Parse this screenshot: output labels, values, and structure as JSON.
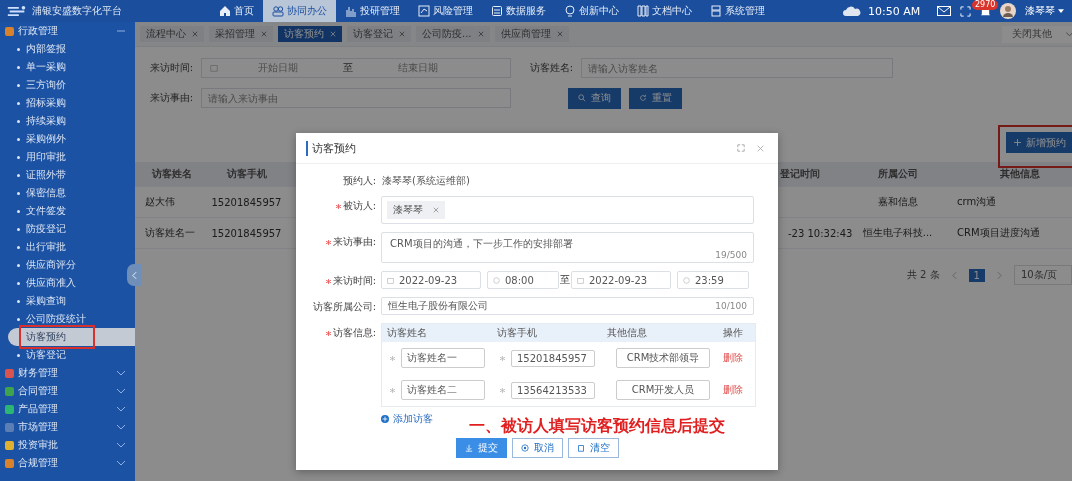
{
  "header": {
    "logo": "浦银安盛数字化平台",
    "nav": [
      {
        "label": "首页",
        "selected": false
      },
      {
        "label": "协同办公",
        "selected": true
      },
      {
        "label": "投研管理",
        "selected": false
      },
      {
        "label": "风险管理",
        "selected": false
      },
      {
        "label": "数据服务",
        "selected": false
      },
      {
        "label": "创新中心",
        "selected": false
      },
      {
        "label": "文档中心",
        "selected": false
      },
      {
        "label": "系统管理",
        "selected": false
      }
    ],
    "time": "10:50 AM",
    "badge": "2970",
    "user": "漆琴琴"
  },
  "sidebar": {
    "groups": [
      {
        "label": "行政管理",
        "color": "#d9822b",
        "expanded": true,
        "children": [
          {
            "label": "内部签报",
            "selected": false,
            "highlighted": false
          },
          {
            "label": "单一采购",
            "selected": false,
            "highlighted": false
          },
          {
            "label": "三方询价",
            "selected": false,
            "highlighted": false
          },
          {
            "label": "招标采购",
            "selected": false,
            "highlighted": false
          },
          {
            "label": "持续采购",
            "selected": false,
            "highlighted": false
          },
          {
            "label": "采购例外",
            "selected": false,
            "highlighted": false
          },
          {
            "label": "用印审批",
            "selected": false,
            "highlighted": false
          },
          {
            "label": "证照外带",
            "selected": false,
            "highlighted": false
          },
          {
            "label": "保密信息",
            "selected": false,
            "highlighted": false
          },
          {
            "label": "文件签发",
            "selected": false,
            "highlighted": false
          },
          {
            "label": "防疫登记",
            "selected": false,
            "highlighted": false
          },
          {
            "label": "出行审批",
            "selected": false,
            "highlighted": false
          },
          {
            "label": "供应商评分",
            "selected": false,
            "highlighted": false
          },
          {
            "label": "供应商准入",
            "selected": false,
            "highlighted": false
          },
          {
            "label": "采购查询",
            "selected": false,
            "highlighted": false
          },
          {
            "label": "公司防疫统计",
            "selected": false,
            "highlighted": false
          },
          {
            "label": "访客预约",
            "selected": true,
            "highlighted": true
          },
          {
            "label": "访客登记",
            "selected": false,
            "highlighted": false
          }
        ]
      },
      {
        "label": "财务管理",
        "color": "#d9534f",
        "expanded": false
      },
      {
        "label": "合同管理",
        "color": "#3fa34d",
        "expanded": false
      },
      {
        "label": "产品管理",
        "color": "#2bb673",
        "expanded": false
      },
      {
        "label": "市场管理",
        "color": "#5b7fb5",
        "expanded": false
      },
      {
        "label": "投资审批",
        "color": "#e0b030",
        "expanded": false
      },
      {
        "label": "合规管理",
        "color": "#d9822b",
        "expanded": false
      }
    ]
  },
  "tabs": [
    {
      "label": "流程中心",
      "selected": false
    },
    {
      "label": "采招管理",
      "selected": false
    },
    {
      "label": "访客预约",
      "selected": true
    },
    {
      "label": "访客登记",
      "selected": false
    },
    {
      "label": "公司防疫...",
      "selected": false
    },
    {
      "label": "供应商管理",
      "selected": false
    }
  ],
  "tabs_menu": "关闭其他",
  "search": {
    "visit_time": {
      "label": "来访时间:",
      "start_placeholder": "开始日期",
      "separator": "至",
      "end_placeholder": "结束日期"
    },
    "visitor_name": {
      "label": "访客姓名:",
      "placeholder": "请输入访客姓名"
    },
    "reason": {
      "label": "来访事由:",
      "placeholder": "请输入来访事由"
    },
    "buttons": [
      "查询",
      "重置"
    ]
  },
  "add_button": {
    "label": "新增预约",
    "highlighted": true
  },
  "table": {
    "columns": [
      "访客姓名",
      "访客手机",
      "登记时间",
      "所属公司",
      "其他信息"
    ],
    "rows": [
      {
        "visitor_name": "赵大伟",
        "visitor_phone": "15201845957",
        "company": "嘉和信息",
        "other_info": "crm沟通"
      },
      {
        "visitor_name": "访客姓名一",
        "visitor_phone": "15201845957",
        "registered_time": "-23 10:32:43",
        "company": "恒生电子科技...",
        "other_info": "CRM项目进度沟通"
      }
    ]
  },
  "pagination": {
    "total": "共 2 条",
    "pages": [
      {
        "label": "1",
        "selected": true
      }
    ],
    "page_size": "10条/页"
  },
  "modal": {
    "title": "访客预约",
    "booker": {
      "label": "预约人:",
      "value": "漆琴琴(系统运维部)"
    },
    "host": {
      "label": "被访人:",
      "required": true,
      "tags": [
        "漆琴琴"
      ]
    },
    "reason": {
      "label": "来访事由:",
      "required": true,
      "value": "CRM项目的沟通，下一步工作的安排部署",
      "count": "19/500"
    },
    "time": {
      "label": "来访时间:",
      "required": true,
      "start_date": "2022-09-23",
      "start_time": "08:00",
      "separator": "至",
      "end_date": "2022-09-23",
      "end_time": "23:59"
    },
    "company": {
      "label": "访客所属公司:",
      "required": false,
      "value": "恒生电子股份有限公司",
      "count": "10/100"
    },
    "visitors": {
      "label": "访客信息:",
      "required": true,
      "columns": [
        "访客姓名",
        "访客手机",
        "其他信息",
        "操作"
      ],
      "rows": [
        {
          "name": "访客姓名一",
          "phone": "15201845957",
          "other": "CRM技术部领导",
          "action": "删除"
        },
        {
          "name": "访客姓名二",
          "phone": "13564213533",
          "other": "CRM开发人员",
          "action": "删除"
        }
      ],
      "add_link": "添加访客"
    },
    "annotation": "一、被访人填写访客预约信息后提交",
    "buttons": [
      "提交",
      "取消",
      "清空"
    ]
  }
}
